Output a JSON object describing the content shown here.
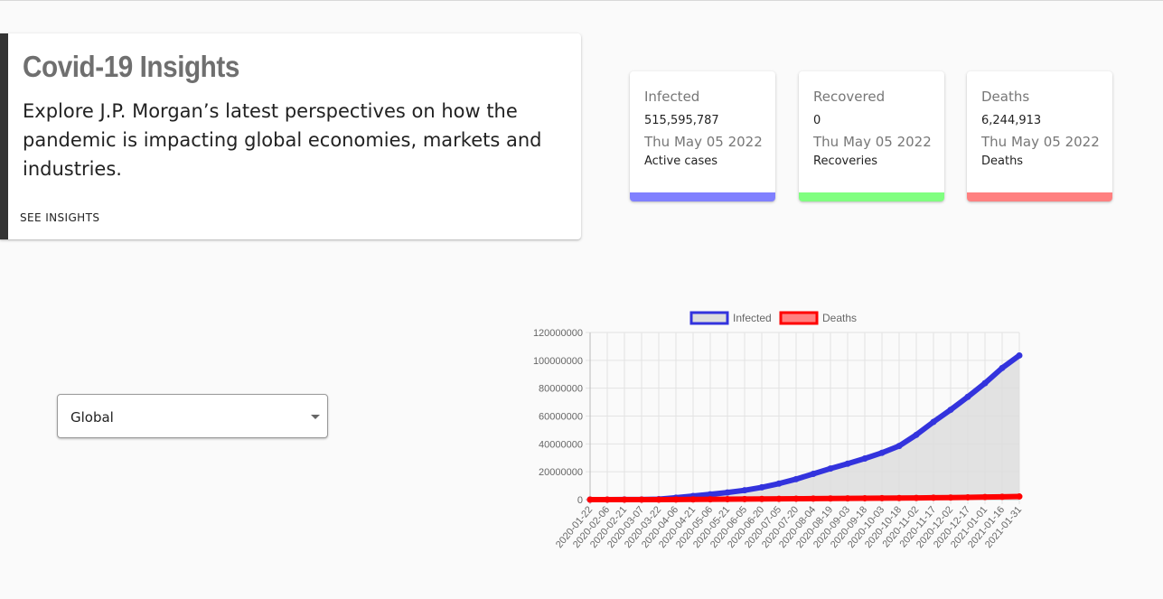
{
  "hero": {
    "title": "Covid-19 Insights",
    "text": "Explore J.P. Morgan’s latest perspectives on how the pandemic is impacting global economies, markets and industries.",
    "link_label": "SEE INSIGHTS"
  },
  "stats": [
    {
      "label": "Infected",
      "value": "515,595,787",
      "date": "Thu May 05 2022",
      "caption": "Active cases",
      "color": "#8080ff"
    },
    {
      "label": "Recovered",
      "value": "0",
      "date": "Thu May 05 2022",
      "caption": "Recoveries",
      "color": "#80ff80"
    },
    {
      "label": "Deaths",
      "value": "6,244,913",
      "date": "Thu May 05 2022",
      "caption": "Deaths",
      "color": "#ff8080"
    }
  ],
  "country_select": {
    "value": "Global",
    "icon": "chevron-down-icon"
  },
  "chart_data": {
    "type": "line",
    "title": "",
    "xlabel": "",
    "ylabel": "",
    "ylim": [
      0,
      120000000
    ],
    "y_ticks": [
      "0",
      "20000000",
      "40000000",
      "60000000",
      "80000000",
      "100000000",
      "120000000"
    ],
    "x_tick_labels": [
      "2020-01-22",
      "2020-02-06",
      "2020-02-21",
      "2020-03-07",
      "2020-03-22",
      "2020-04-06",
      "2020-04-21",
      "2020-05-06",
      "2020-05-21",
      "2020-06-05",
      "2020-06-20",
      "2020-07-05",
      "2020-07-20",
      "2020-08-04",
      "2020-08-19",
      "2020-09-03",
      "2020-09-18",
      "2020-10-03",
      "2020-10-18",
      "2020-11-02",
      "2020-11-17",
      "2020-12-02",
      "2020-12-17",
      "2021-01-01",
      "2021-01-16",
      "2021-01-31"
    ],
    "grid": true,
    "legend_position": "top",
    "series": [
      {
        "name": "Infected",
        "color": "#3333dd",
        "fill": "#dddddd",
        "x": [
          "2020-01-22",
          "2020-02-06",
          "2020-02-21",
          "2020-03-07",
          "2020-03-22",
          "2020-04-06",
          "2020-04-21",
          "2020-05-06",
          "2020-05-21",
          "2020-06-05",
          "2020-06-20",
          "2020-07-05",
          "2020-07-20",
          "2020-08-04",
          "2020-08-19",
          "2020-09-03",
          "2020-09-18",
          "2020-10-03",
          "2020-10-18",
          "2020-11-02",
          "2020-11-17",
          "2020-12-02",
          "2020-12-17",
          "2021-01-01",
          "2021-01-16",
          "2021-01-31"
        ],
        "values": [
          600,
          31000,
          77000,
          110000,
          340000,
          1350000,
          2600000,
          3800000,
          5100000,
          6700000,
          8800000,
          11500000,
          14700000,
          18500000,
          22300000,
          25800000,
          29500000,
          33600000,
          38500000,
          46500000,
          55800000,
          64500000,
          73800000,
          83600000,
          94500000,
          103500000
        ]
      },
      {
        "name": "Deaths",
        "color": "#ff0000",
        "fill": "#ff8080",
        "x": [
          "2020-01-22",
          "2020-02-06",
          "2020-02-21",
          "2020-03-07",
          "2020-03-22",
          "2020-04-06",
          "2020-04-21",
          "2020-05-06",
          "2020-05-21",
          "2020-06-05",
          "2020-06-20",
          "2020-07-05",
          "2020-07-20",
          "2020-08-04",
          "2020-08-19",
          "2020-09-03",
          "2020-09-18",
          "2020-10-03",
          "2020-10-18",
          "2020-11-02",
          "2020-11-17",
          "2020-12-02",
          "2020-12-17",
          "2021-01-01",
          "2021-01-16",
          "2021-01-31"
        ],
        "values": [
          17,
          600,
          2250,
          3500,
          15000,
          75000,
          180000,
          265000,
          340000,
          395000,
          465000,
          535000,
          610000,
          700000,
          790000,
          870000,
          940000,
          1030000,
          1110000,
          1220000,
          1340000,
          1490000,
          1660000,
          1830000,
          2020000,
          2240000
        ]
      }
    ]
  }
}
